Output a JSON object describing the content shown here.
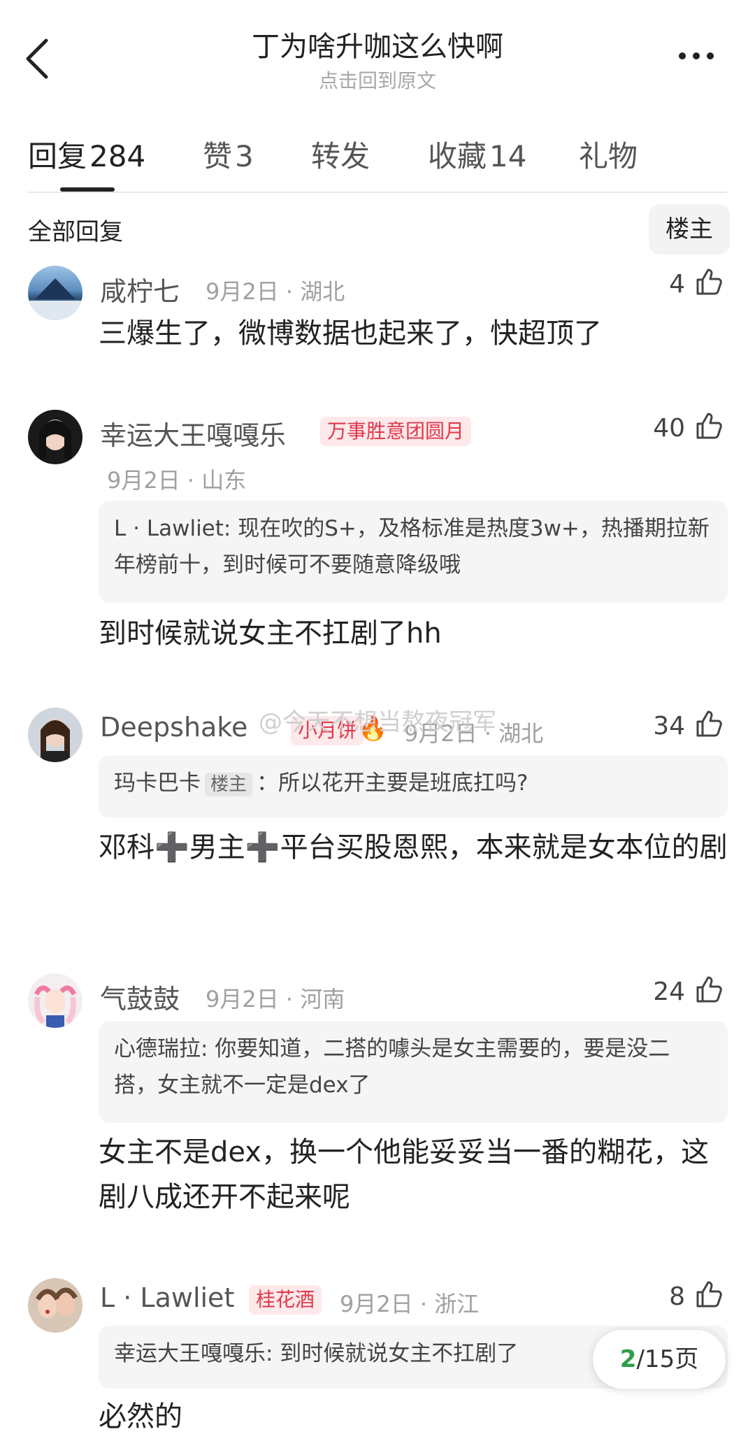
{
  "header": {
    "title": "丁为啥升咖这么快啊",
    "subtitle": "点击回到原文"
  },
  "tabs": [
    {
      "label": "回复",
      "count": "284"
    },
    {
      "label": "赞",
      "count": "3"
    },
    {
      "label": "转发",
      "count": ""
    },
    {
      "label": "收藏",
      "count": "14"
    },
    {
      "label": "礼物",
      "count": ""
    }
  ],
  "section": {
    "all_replies": "全部回复",
    "owner_filter": "楼主"
  },
  "comments": [
    {
      "name": "咸柠七",
      "date": "9月2日 · 湖北",
      "likes": "4",
      "text": "三爆生了，微博数据也起来了，快超顶了"
    },
    {
      "name": "幸运大王嘎嘎乐",
      "badge": "万事胜意团圆月",
      "date": "9月2日 · 山东",
      "likes": "40",
      "quote": "L · Lawliet: 现在吹的S+，及格标准是热度3w+，热播期拉新年榜前十，到时候可不要随意降级哦",
      "text": "到时候就说女主不扛剧了hh"
    },
    {
      "name": "Deepshake",
      "badge": "小月饼",
      "date": "9月2日 · 湖北",
      "likes": "34",
      "quote_author": "玛卡巴卡",
      "quote_owner_tag": "楼主",
      "quote_text": "：所以花开主要是班底扛吗?",
      "text": "邓科➕男主➕平台买股恩熙，本来就是女本位的剧"
    },
    {
      "name": "气鼓鼓",
      "date": "9月2日 · 河南",
      "likes": "24",
      "quote": "心德瑞拉: 你要知道，二搭的噱头是女主需要的，要是没二搭，女主就不一定是dex了",
      "text": "女主不是dex，换一个他能妥妥当一番的糊花，这剧八成还开不起来呢"
    },
    {
      "name": "L · Lawliet",
      "badge": "桂花酒",
      "date": "9月2日 · 浙江",
      "likes": "8",
      "quote": "幸运大王嘎嘎乐: 到时候就说女主不扛剧了",
      "text": "必然的"
    }
  ],
  "watermark": "@今天不想当熬夜冠军",
  "pager": {
    "current": "2",
    "total_label": "/15页"
  },
  "colors": {
    "badge_red": "#e0394a",
    "pager_green": "#2f9e4a"
  }
}
